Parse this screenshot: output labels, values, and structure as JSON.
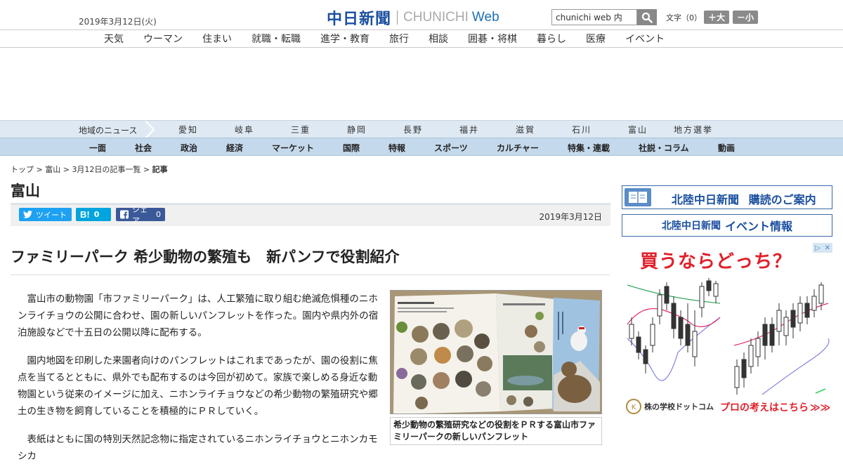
{
  "header": {
    "date": "2019年3月12日(火)",
    "logo_jp": "中日新聞",
    "logo_en": "CHUNICHI",
    "logo_web": "Web",
    "search_value": "chunichi web 内",
    "font_label": "文字（0）",
    "font_larger": "＋大",
    "font_smaller": "－小"
  },
  "nav_top": [
    "天気",
    "ウーマン",
    "住まい",
    "就職・転職",
    "進学・教育",
    "旅行",
    "相談",
    "囲碁・将棋",
    "暮らし",
    "医療",
    "イベント"
  ],
  "nav_region": {
    "label": "地域のニュース",
    "items": [
      "愛知",
      "岐阜",
      "三重",
      "静岡",
      "長野",
      "福井",
      "滋賀",
      "石川",
      "富山",
      "地方選挙"
    ]
  },
  "nav_section": [
    "一面",
    "社会",
    "政治",
    "経済",
    "マーケット",
    "国際",
    "特報",
    "スポーツ",
    "カルチャー",
    "特集・連載",
    "社説・コラム",
    "動画"
  ],
  "breadcrumb": {
    "top": "トップ",
    "sep": " > ",
    "pref": "富山",
    "list": "3月12日の記事一覧",
    "current": "記事"
  },
  "page_title": "富山",
  "share": {
    "tweet": "ツイート",
    "hatena_count": "0",
    "fb_label": "シェア",
    "fb_count": "0"
  },
  "article": {
    "date": "2019年3月12日",
    "headline": "ファミリーパーク 希少動物の繁殖も　新パンフで役割紹介",
    "paragraphs": [
      "富山市の動物園「市ファミリーパーク」は、人工繁殖に取り組む絶滅危惧種のニホンライチョウの公開に合わせ、園の新しいパンフレットを作った。園内や県内外の宿泊施設などで十五日の公開以降に配布する。",
      "園内地図を印刷した来園者向けのパンフレットはこれまであったが、園の役割に焦点を当てるとともに、県外でも配布するのは今回が初めて。家族で楽しめる身近な動物園という従来のイメージに加え、ニホンライチョウなどの希少動物の繁殖研究や郷土の生き物を飼育していることを積極的にＰＲしていく。",
      "表紙はともに国の特別天然記念物に指定されているニホンライチョウとニホンカモシカ"
    ],
    "photo_caption": "希少動物の繁殖研究などの役割をＰＲする富山市ファミリーパークの新しいパンフレット"
  },
  "sidebar": {
    "banner1_label": "北陸中日新聞",
    "banner1_suffix": "購読のご案内",
    "banner2_label": "北陸中日新聞",
    "banner2_suffix": "イベント情報"
  },
  "ad": {
    "headline": "買うならどっち？",
    "brand": "株の学校ドットコム",
    "cta": "プロの考えはこちら",
    "cta_arrows": "≫≫"
  },
  "colors": {
    "brand_blue": "#1a4fa0",
    "twitter": "#1da1f2",
    "hatena": "#00a4de",
    "facebook": "#3b5998",
    "ad_red": "#e0202a",
    "region_band": "#dfe9f3",
    "section_band": "#c5d9ec"
  }
}
